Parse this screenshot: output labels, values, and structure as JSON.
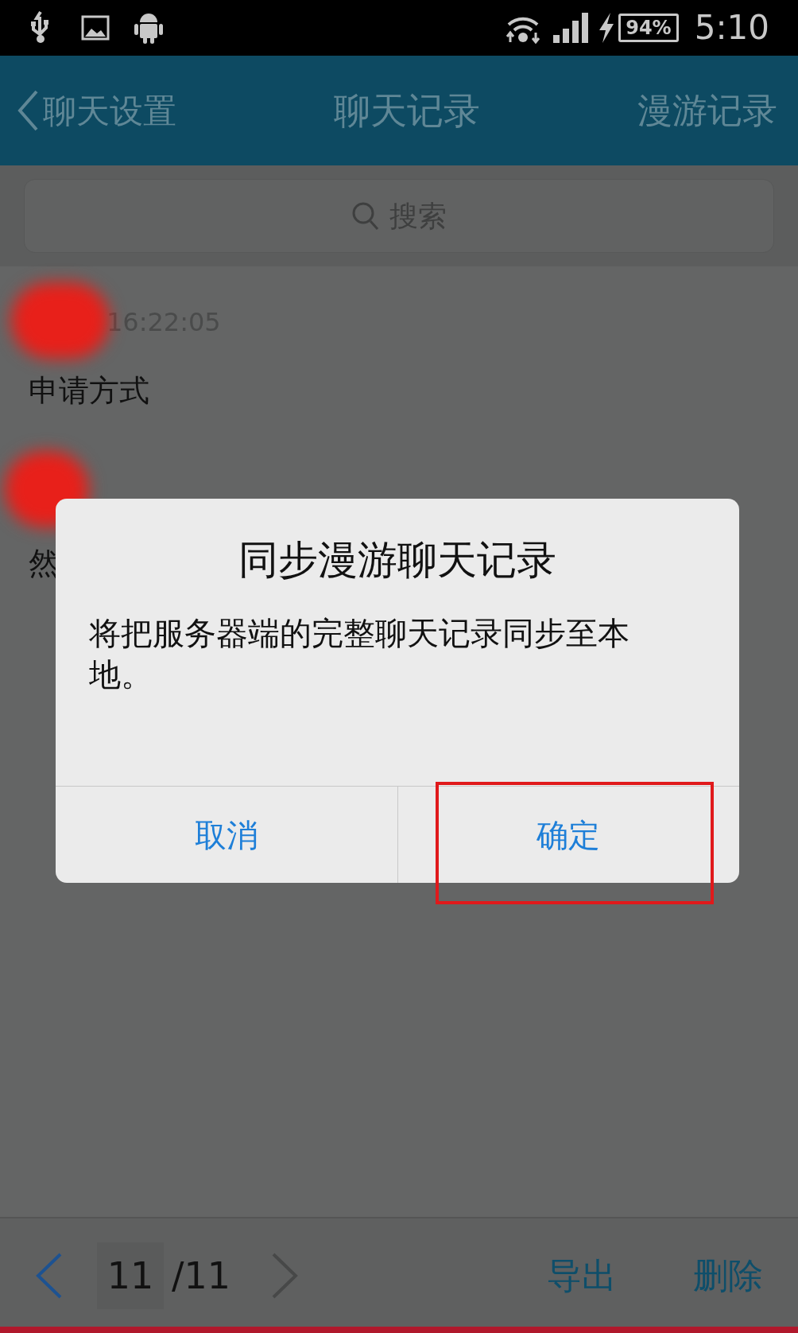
{
  "status_bar": {
    "battery": "94%",
    "time": "5:10"
  },
  "header": {
    "back": "聊天设置",
    "title": "聊天记录",
    "action": "漫游记录"
  },
  "search": {
    "placeholder": "搜索"
  },
  "messages": [
    {
      "time": "16:22:05",
      "text": "申请方式"
    },
    {
      "text": "然"
    }
  ],
  "dialog": {
    "title": "同步漫游聊天记录",
    "body": "将把服务器端的完整聊天记录同步至本地。",
    "buttons": [
      {
        "label": "取消",
        "highlighted": false
      },
      {
        "label": "确定",
        "highlighted": true
      }
    ]
  },
  "footer": {
    "page": "11",
    "total": "/11",
    "actions": [
      "导出",
      "删除"
    ]
  }
}
